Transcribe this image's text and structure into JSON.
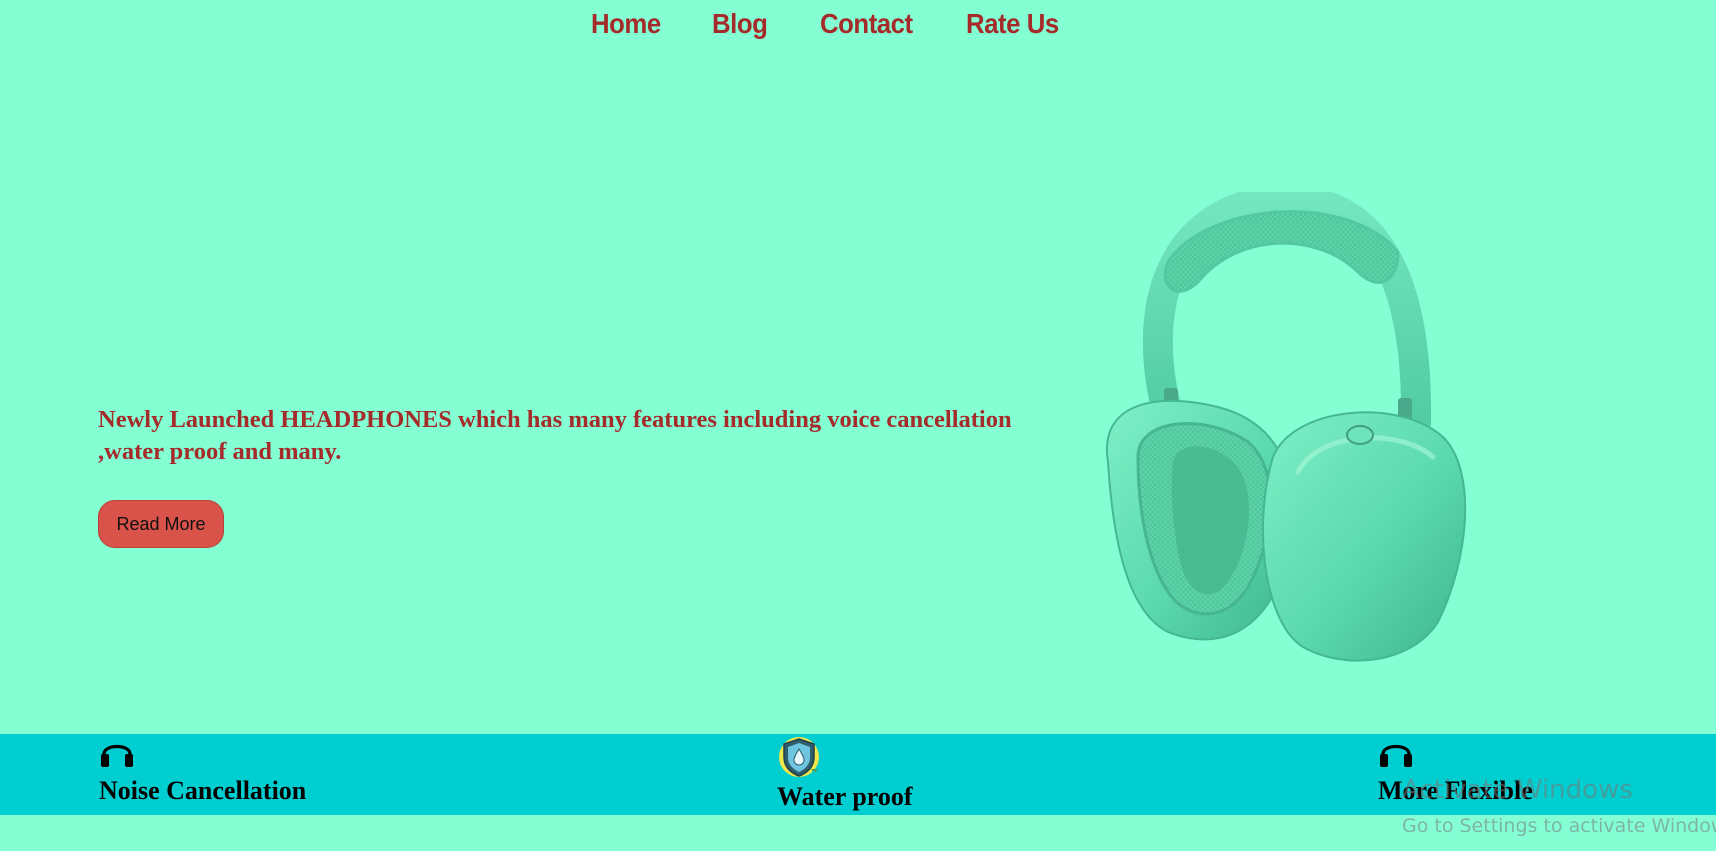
{
  "nav": {
    "items": [
      {
        "label": "Home"
      },
      {
        "label": "Blog"
      },
      {
        "label": "Contact"
      },
      {
        "label": "Rate Us"
      }
    ]
  },
  "hero": {
    "text": "Newly Launched HEADPHONES which has many features including voice cancellation ,water proof and many.",
    "button_label": "Read More",
    "image": {
      "icon": "headphones-image",
      "color": "#5FE6B6"
    }
  },
  "features": [
    {
      "icon": "headphones-icon",
      "title": "Noise Cancellation"
    },
    {
      "icon": "water-shield-icon",
      "title": "Water proof"
    },
    {
      "icon": "headphones-icon",
      "title": "More Flexible"
    }
  ],
  "watermark": {
    "line1": "Activate Windows",
    "line2": "Go to Settings to activate Windows."
  },
  "colors": {
    "background": "#84FFD4",
    "nav_text": "#A52A2A",
    "hero_text": "#A52A2A",
    "button_bg": "#D9534A",
    "features_bar": "#00CED1"
  }
}
